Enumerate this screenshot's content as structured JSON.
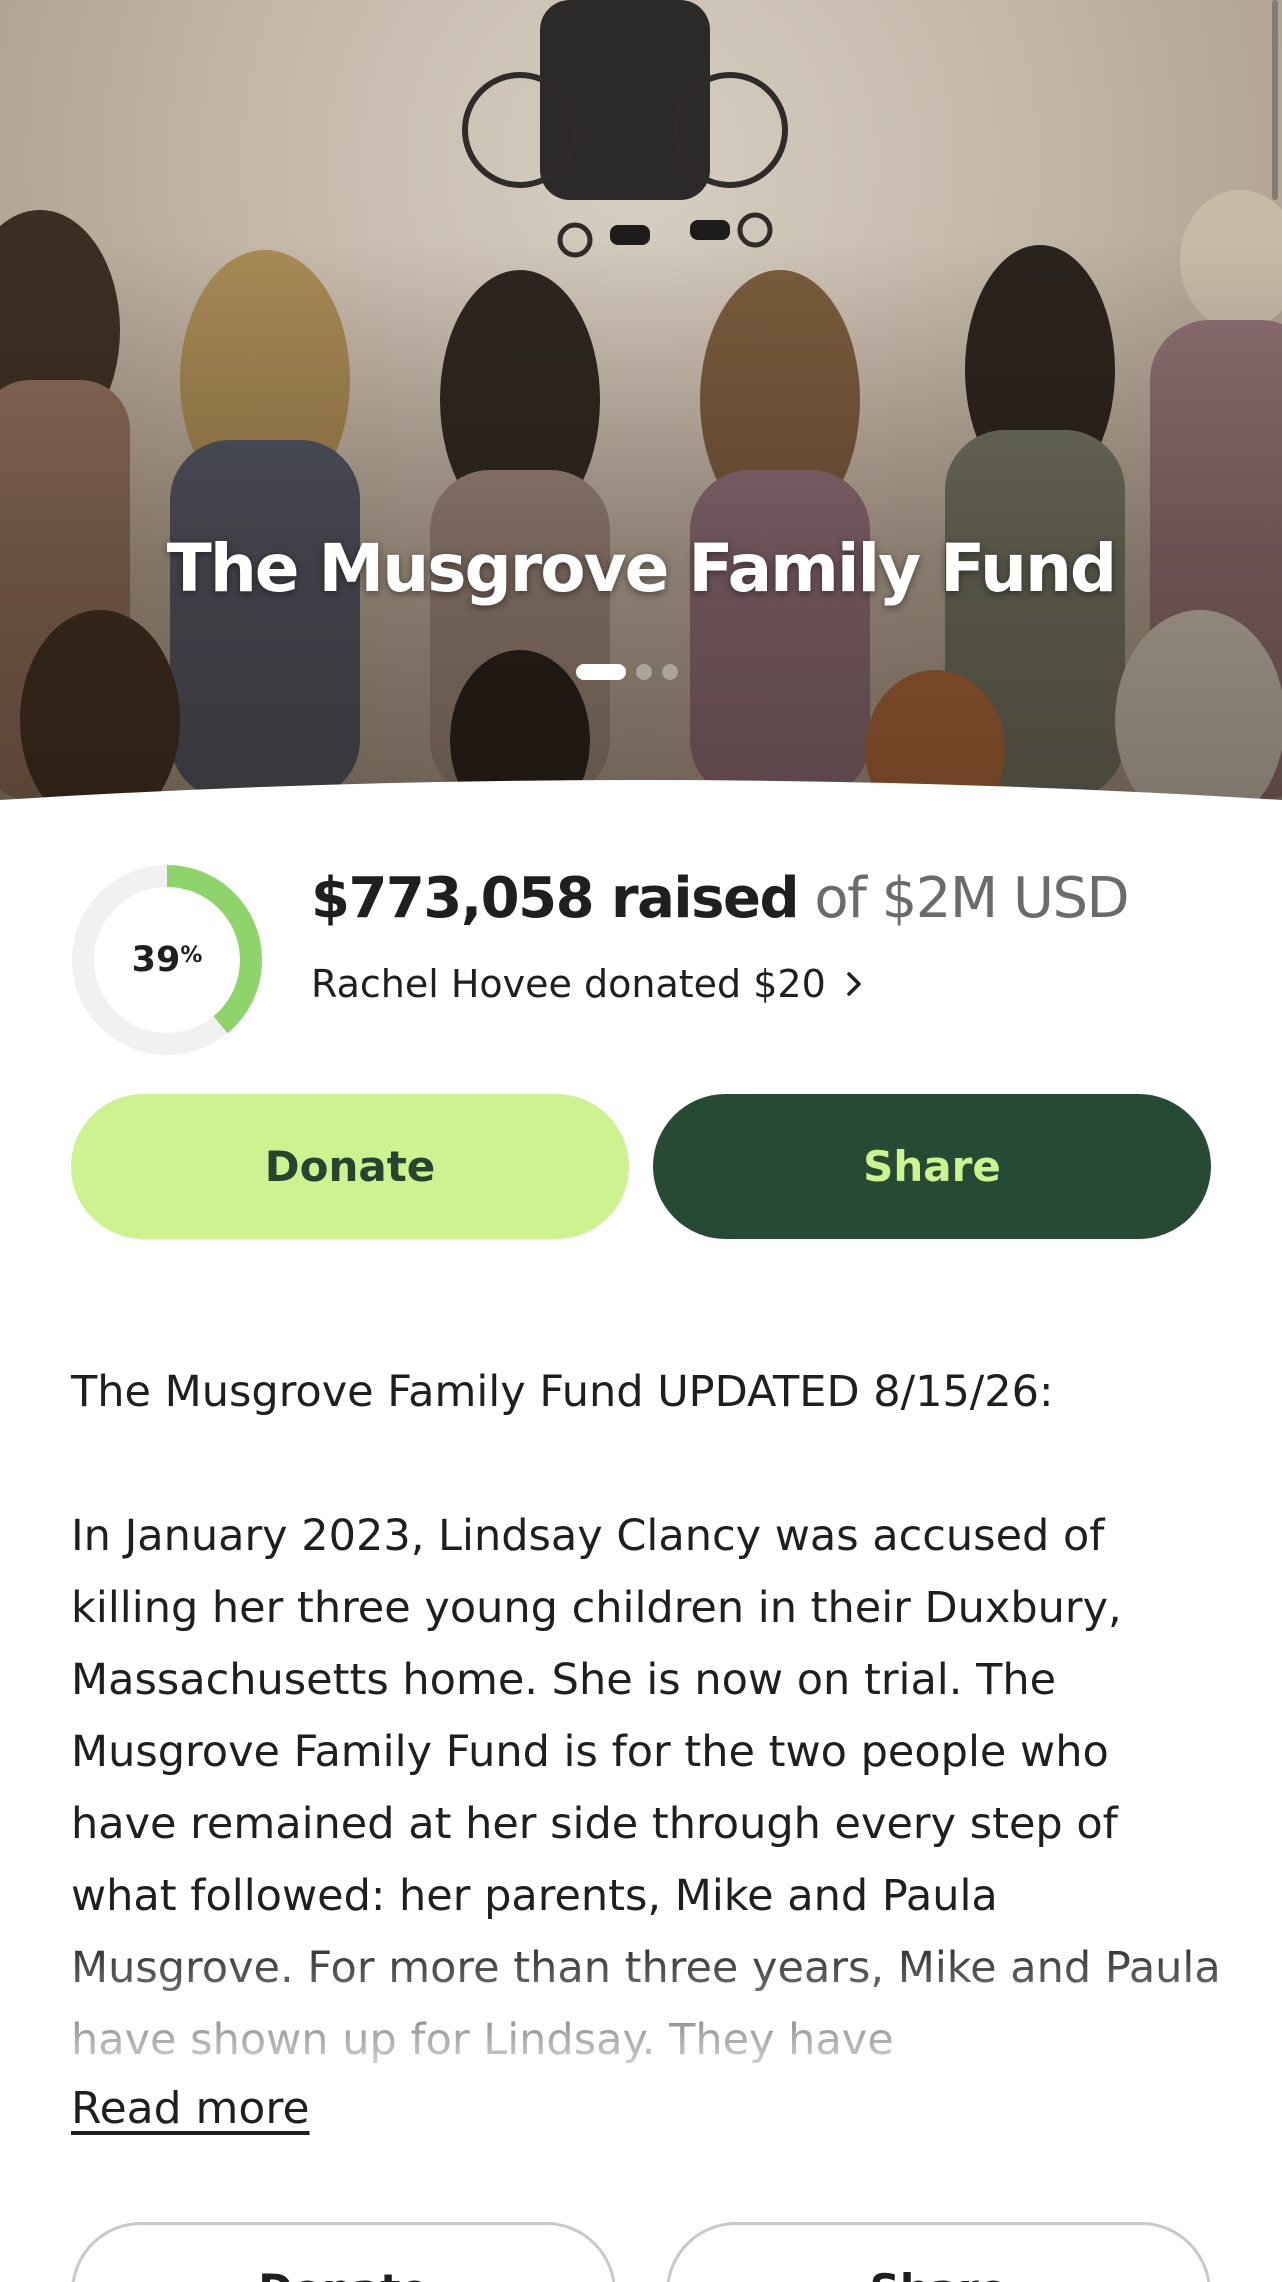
{
  "hero": {
    "title": "The Musgrove Family Fund",
    "carousel": {
      "slide_count": 3,
      "active_index": 0
    }
  },
  "progress": {
    "percent": 39,
    "percent_label": "39",
    "percent_sign": "%",
    "raised_text": "$773,058 raised",
    "goal_text": "of $2M USD",
    "recent_donation": "Rachel Hovee donated $20",
    "ring_color": "#8fd46a",
    "track_color": "#f1f1f1"
  },
  "actions": {
    "donate_label": "Donate",
    "share_label": "Share"
  },
  "story": {
    "heading": "The Musgrove Family Fund UPDATED 8/15/26:",
    "body": "In January 2023, Lindsay Clancy was accused of killing her three young children in their Duxbury, Massachusetts home. She is now on trial. The Musgrove Family Fund is for the two people who have remained at her side through every step of what followed: her parents, Mike and Paula Musgrove. For more than three years, Mike and Paula have shown up for Lindsay. They have",
    "read_more": "Read more"
  },
  "bottom_actions": {
    "donate_label": "Donate",
    "share_label": "Share"
  },
  "colors": {
    "donate_bg": "#cdf391",
    "share_bg": "#274a35",
    "brand_green": "#cdf391"
  }
}
